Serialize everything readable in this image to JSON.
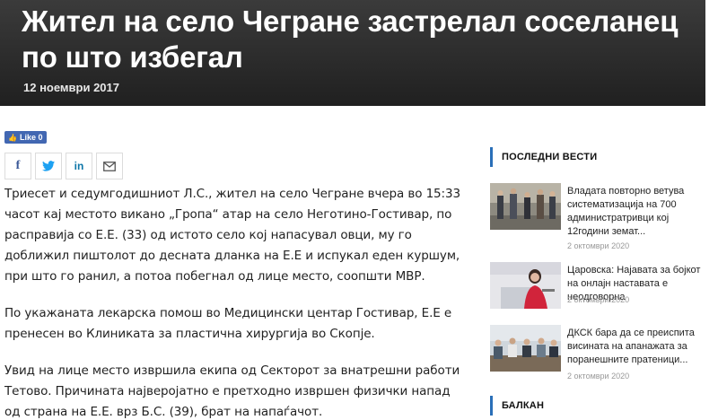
{
  "article": {
    "title": "Жител на село Чегране застрелал соселанец по што избегал",
    "date": "12 ноември 2017",
    "paragraphs": [
      "Триесет и седумгодишниот Л.С., жител на село Чегране вчера во 15:33 часот кај местото викано „Гропа“ атар на село Неготино-Гостивар, по расправија со Е.Е. (33) од истото село кој напасувал овци, му го доближил пиштолот до десната дланка на Е.Е и испукал еден куршум, при што го ранил, а потоа побегнал од лице место, соопшти МВР.",
      "По укажаната лекарска помош во Медицински центар Гостивар, Е.Е е пренесен во Клиниката за пластична хирургија во Скопје.",
      "Увид на лице место извршила екипа од Секторот за внатрешни работи Тетово. Причината најверојатно е претходно извршен физички напад од страна на Е.Е. врз Б.С. (39), брат на напаѓачот."
    ]
  },
  "social": {
    "fb_like_label": "Like 0",
    "share_icons": [
      "facebook-icon",
      "twitter-icon",
      "linkedin-icon",
      "email-icon"
    ]
  },
  "sidebar": {
    "latest_title": "ПОСЛЕДНИ ВЕСТИ",
    "news": [
      {
        "title": "Владата повторно ветува систематизација на 700 администратривци кој 12години земат...",
        "date": "2 октомври 2020"
      },
      {
        "title": "Царовска: Најавата за бојкот на онлајн наставата е неодговорна",
        "date": "2 октомври 2020"
      },
      {
        "title": "ДКСК бара да се преиспита висината на апанажата за поранешните пратеници...",
        "date": "2 октомври 2020"
      }
    ],
    "balkan_title": "БАЛКАН"
  },
  "colors": {
    "accent": "#2a6fb8",
    "hero_bg": "#2c2c2c",
    "fb_blue": "#4267b2"
  }
}
